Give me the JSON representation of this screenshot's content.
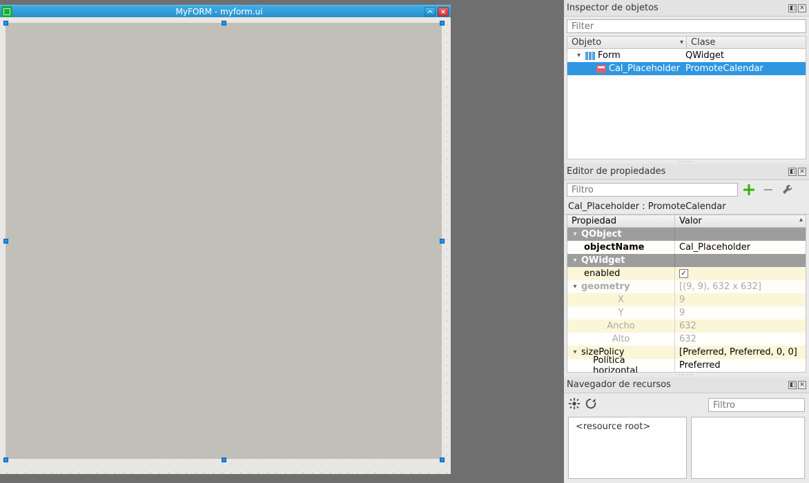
{
  "window": {
    "title": "MyFORM - myform.ui"
  },
  "inspector": {
    "title": "Inspector de objetos",
    "filter_placeholder": "Filter",
    "col_object": "Objeto",
    "col_class": "Clase",
    "rows": [
      {
        "name": "Form",
        "cls": "QWidget"
      },
      {
        "name": "Cal_Placeholder",
        "cls": "PromoteCalendar"
      }
    ]
  },
  "prop": {
    "title": "Editor de propiedades",
    "filter_placeholder": "Filtro",
    "crumb": "Cal_Placeholder : PromoteCalendar",
    "col_prop": "Propiedad",
    "col_val": "Valor",
    "group_qobject": "QObject",
    "objectName_label": "objectName",
    "objectName_value": "Cal_Placeholder",
    "group_qwidget": "QWidget",
    "enabled_label": "enabled",
    "geometry_label": "geometry",
    "geometry_value": "[(9, 9), 632 x 632]",
    "x_label": "X",
    "x_value": "9",
    "y_label": "Y",
    "y_value": "9",
    "w_label": "Ancho",
    "w_value": "632",
    "h_label": "Alto",
    "h_value": "632",
    "sizepolicy_label": "sizePolicy",
    "sizepolicy_value": "[Preferred, Preferred, 0, 0]",
    "hpolicy_label": "Política horizontal",
    "hpolicy_value": "Preferred"
  },
  "res": {
    "title": "Navegador de recursos",
    "filter_placeholder": "Filtro",
    "root": "<resource root>"
  }
}
